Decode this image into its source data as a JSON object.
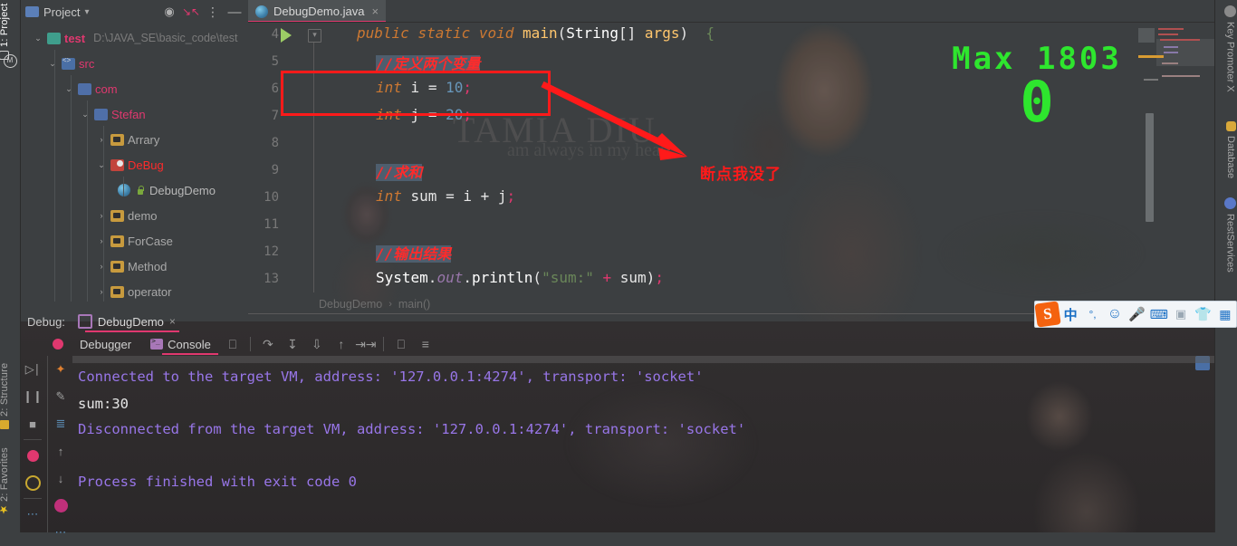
{
  "left_strip": {
    "items": [
      {
        "label": "1: Project",
        "icon": "project-icon",
        "selected": true
      },
      {
        "label": "2: Structure",
        "icon": "structure-icon",
        "selected": false
      },
      {
        "label": "2: Favorites",
        "icon": "star-icon",
        "selected": false
      }
    ],
    "maven_icon": "maven-icon"
  },
  "project_panel": {
    "title": "Project",
    "chevron": "▾",
    "header_icons": [
      "target-icon",
      "collapse-all-icon",
      "more-options-icon",
      "hide-icon"
    ],
    "tree": [
      {
        "label": "test",
        "path": "D:\\JAVA_SE\\basic_code\\test",
        "indent": 0,
        "twist": "⌄",
        "icon": "module-folder-icon",
        "color": "#e0386f"
      },
      {
        "label": "src",
        "path": "",
        "indent": 1,
        "twist": "⌄",
        "icon": "source-root-icon",
        "color": "#e0386f"
      },
      {
        "label": "com",
        "path": "",
        "indent": 2,
        "twist": "⌄",
        "icon": "package-icon",
        "color": "#e0386f"
      },
      {
        "label": "Stefan",
        "path": "",
        "indent": 3,
        "twist": "⌄",
        "icon": "package-icon",
        "color": "#e0386f"
      },
      {
        "label": "Arrary",
        "path": "",
        "indent": 4,
        "twist": "›",
        "icon": "folder-icon",
        "color": "#a9a9a9"
      },
      {
        "label": "DeBug",
        "path": "",
        "indent": 4,
        "twist": "⌄",
        "icon": "folder-red-icon",
        "color": "#ff2b2b"
      },
      {
        "label": "DebugDemo",
        "path": "",
        "indent": 5,
        "twist": "",
        "icon": "java-class-icon",
        "color": "#b8b8b8"
      },
      {
        "label": "demo",
        "path": "",
        "indent": 4,
        "twist": "›",
        "icon": "folder-icon",
        "color": "#a9a9a9"
      },
      {
        "label": "ForCase",
        "path": "",
        "indent": 4,
        "twist": "›",
        "icon": "folder-icon",
        "color": "#a9a9a9"
      },
      {
        "label": "Method",
        "path": "",
        "indent": 4,
        "twist": "›",
        "icon": "folder-icon",
        "color": "#a9a9a9"
      },
      {
        "label": "operator",
        "path": "",
        "indent": 4,
        "twist": "›",
        "icon": "folder-icon",
        "color": "#a9a9a9"
      }
    ]
  },
  "editor": {
    "tab": {
      "label": "DebugDemo.java",
      "close": "×",
      "icon": "java-file-icon"
    },
    "breadcrumb": {
      "class": "DebugDemo",
      "sep": "›",
      "method": "main()"
    },
    "lines": [
      {
        "no": "4",
        "run_arrow": true,
        "fold": true
      },
      {
        "no": "5",
        "run_arrow": false,
        "fold": false
      },
      {
        "no": "6",
        "run_arrow": false,
        "fold": false
      },
      {
        "no": "7",
        "run_arrow": false,
        "fold": false
      },
      {
        "no": "8",
        "run_arrow": false,
        "fold": false
      },
      {
        "no": "9",
        "run_arrow": false,
        "fold": false
      },
      {
        "no": "10",
        "run_arrow": false,
        "fold": false
      },
      {
        "no": "11",
        "run_arrow": false,
        "fold": false
      },
      {
        "no": "12",
        "run_arrow": false,
        "fold": false
      },
      {
        "no": "13",
        "run_arrow": false,
        "fold": false
      }
    ],
    "code": {
      "l4_public": "public",
      "l4_static": "static",
      "l4_void": "void",
      "l4_main": "main",
      "l4_paren1": "(",
      "l4_String": "String",
      "l4_brackets": "[]",
      "l4_args": "args",
      "l4_paren2": ")",
      "l4_brace": "{",
      "l5_comment": "//定义两个变量",
      "l6_int": "int",
      "l6_var": " i ",
      "l6_eq": "= ",
      "l6_val": "10",
      "l6_semi": ";",
      "l7_int": "int",
      "l7_var": " j ",
      "l7_eq": "= ",
      "l7_val": "20",
      "l7_semi": ";",
      "l9_comment": "//求和",
      "l10_int": "int",
      "l10_expr": " sum = i + j",
      "l10_semi": ";",
      "l12_comment": "//输出结果",
      "l13_system": "System",
      "l13_dot1": ".",
      "l13_out": "out",
      "l13_dot2": ".",
      "l13_println": "println",
      "l13_p1": "(",
      "l13_str": "\"sum:\"",
      "l13_plus": " + ",
      "l13_sum": "sum",
      "l13_p2": ")",
      "l13_semi": ";"
    }
  },
  "annotations": {
    "red_box_target": "int i = 10;",
    "note_text": "断点我没了",
    "note_color": "#ff1a1a",
    "arrow": "red-arrow-icon"
  },
  "overlay": {
    "max_label": "Max 1803",
    "big_number": "0",
    "color": "#2ee62e"
  },
  "wallpaper": {
    "watermark_big": "TAMIA DIU",
    "watermark_small": "am always in my heart"
  },
  "debug_window": {
    "header_word": "Debug:",
    "session_tab": "DebugDemo",
    "session_close": "×",
    "tabs": [
      {
        "label": "Debugger",
        "selected": false,
        "icon": "debugger-icon"
      },
      {
        "label": "Console",
        "selected": true,
        "icon": "console-icon"
      }
    ],
    "toolbar_icons": [
      "bug-icon",
      "frames-icon",
      "step-over-icon",
      "step-into-icon",
      "force-step-into-icon",
      "step-out-icon",
      "run-to-cursor-icon",
      "evaluate-icon",
      "settings-icon"
    ],
    "left_column_icons": [
      "resume-icon",
      "pause-icon",
      "stop-icon",
      "mute-breakpoints-icon",
      "view-breakpoints-icon",
      "more-icon"
    ],
    "left_column2_icons": [
      "rerun-icon",
      "edit-config-icon",
      "sort-icon",
      "scroll-up-icon",
      "scroll-down-icon",
      "soft-wrap-icon",
      "more-icon"
    ],
    "console_lines": [
      {
        "text": "Connected to the target VM, address: '127.0.0.1:4274', transport: 'socket'",
        "color": "purple"
      },
      {
        "text": "sum:30",
        "color": "white"
      },
      {
        "text": "Disconnected from the target VM, address: '127.0.0.1:4274', transport: 'socket'",
        "color": "purple"
      },
      {
        "text": "",
        "color": "purple"
      },
      {
        "text": "Process finished with exit code 0",
        "color": "purple"
      }
    ]
  },
  "right_strip": {
    "items": [
      {
        "label": "Key Promoter X",
        "icon": "key-promoter-icon"
      },
      {
        "label": "Database",
        "icon": "database-icon"
      },
      {
        "label": "RestServices",
        "icon": "rest-services-icon"
      }
    ]
  },
  "ime_bar": {
    "logo": "S",
    "mode": "中",
    "icons": [
      "punctuation-icon",
      "emoji-icon",
      "voice-input-icon",
      "soft-keyboard-icon",
      "screenshot-icon",
      "skin-icon",
      "toolbox-icon"
    ]
  }
}
